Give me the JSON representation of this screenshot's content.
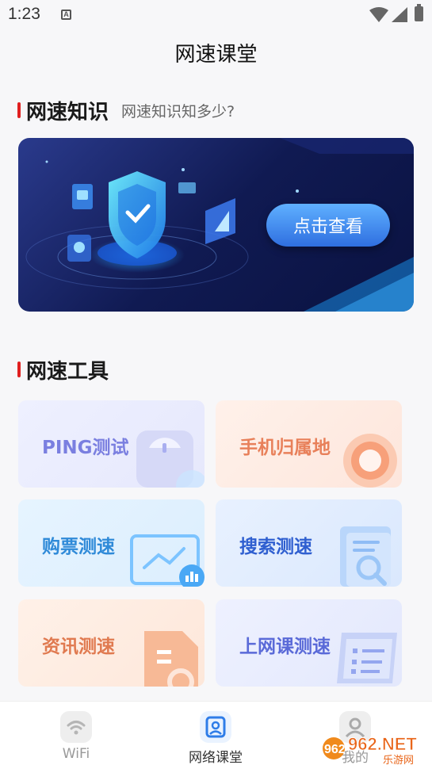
{
  "status_bar": {
    "time": "1:23"
  },
  "header": {
    "title": "网速课堂"
  },
  "knowledge": {
    "title": "网速知识",
    "subtitle": "网速知识知多少?",
    "banner_button": "点击查看"
  },
  "tools": {
    "title": "网速工具",
    "items": [
      {
        "label": "PING测试",
        "color": "#7a7fe0"
      },
      {
        "label": "手机归属地",
        "color": "#e8805a"
      },
      {
        "label": "购票测速",
        "color": "#2f8ad8"
      },
      {
        "label": "搜索测速",
        "color": "#2f5fd0"
      },
      {
        "label": "资讯测速",
        "color": "#e07a50"
      },
      {
        "label": "上网课测速",
        "color": "#5a6ad8"
      }
    ]
  },
  "tabbar": {
    "items": [
      {
        "label": "WiFi",
        "icon": "wifi-icon"
      },
      {
        "label": "网络课堂",
        "icon": "classroom-icon"
      },
      {
        "label": "我的",
        "icon": "profile-icon"
      }
    ]
  },
  "watermark": {
    "text": "962.NET",
    "sub": "乐游网"
  }
}
